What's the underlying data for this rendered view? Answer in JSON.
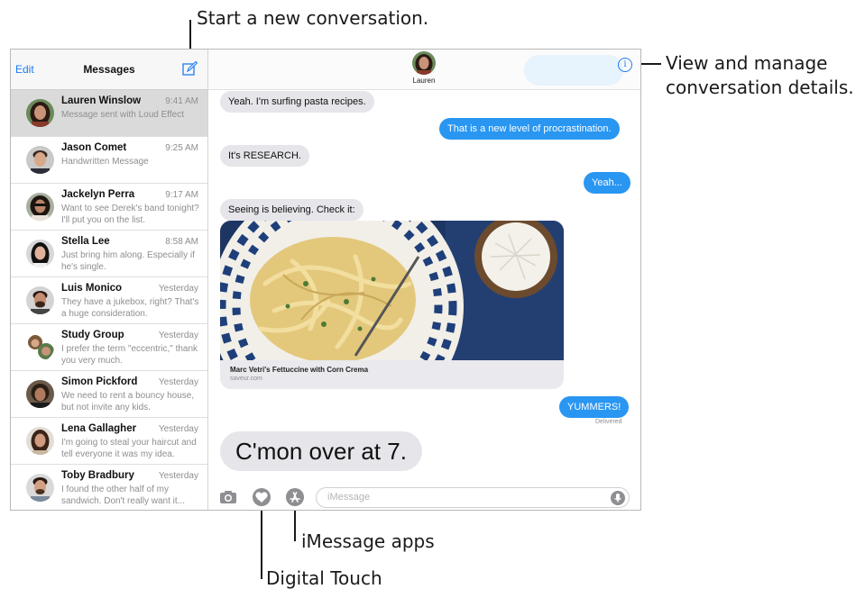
{
  "callouts": {
    "new_conversation": "Start a new conversation.",
    "details_line1": "View and manage",
    "details_line2": "conversation details.",
    "imessage_apps": "iMessage apps",
    "digital_touch": "Digital Touch"
  },
  "sidebar": {
    "edit_label": "Edit",
    "title": "Messages",
    "compose_icon": "compose-icon",
    "conversations": [
      {
        "name": "Lauren Winslow",
        "time": "9:41 AM",
        "preview": "Message sent with Loud Effect",
        "active": true
      },
      {
        "name": "Jason Comet",
        "time": "9:25 AM",
        "preview": "Handwritten Message"
      },
      {
        "name": "Jackelyn Perra",
        "time": "9:17 AM",
        "preview": "Want to see Derek's band tonight? I'll put you on the list."
      },
      {
        "name": "Stella Lee",
        "time": "8:58 AM",
        "preview": "Just bring him along. Especially if he's single."
      },
      {
        "name": "Luis Monico",
        "time": "Yesterday",
        "preview": "They have a jukebox, right? That's a huge consideration."
      },
      {
        "name": "Study Group",
        "time": "Yesterday",
        "preview": "I prefer the term \"eccentric,\" thank you very much."
      },
      {
        "name": "Simon Pickford",
        "time": "Yesterday",
        "preview": "We need to rent a bouncy house, but not invite any kids."
      },
      {
        "name": "Lena Gallagher",
        "time": "Yesterday",
        "preview": "I'm going to steal your haircut and tell everyone it was my idea."
      },
      {
        "name": "Toby Bradbury",
        "time": "Yesterday",
        "preview": "I found the other half of my sandwich. Don't really want it..."
      }
    ]
  },
  "chat": {
    "contact_name": "Lauren",
    "info_icon": "info-icon",
    "messages": [
      {
        "text": "Yeah. I'm surfing pasta recipes.",
        "direction": "incoming"
      },
      {
        "text": "That is a new level of procrastination.",
        "direction": "outgoing"
      },
      {
        "text": "It's RESEARCH.",
        "direction": "incoming"
      },
      {
        "text": "Yeah...",
        "direction": "outgoing"
      },
      {
        "text": "Seeing is believing. Check it:",
        "direction": "incoming"
      },
      {
        "text": "YUMMERS!",
        "direction": "outgoing"
      },
      {
        "text": "C'mon over at 7.",
        "direction": "incoming",
        "effect": "loud"
      }
    ],
    "link_preview": {
      "title": "Marc Vetri's Fettuccine with Corn Crema",
      "domain": "saveur.com"
    },
    "delivered_label": "Delivered",
    "input": {
      "placeholder": "iMessage",
      "icons": [
        "camera-icon",
        "digital-touch-icon",
        "app-store-icon",
        "microphone-icon"
      ]
    }
  },
  "colors": {
    "accent": "#1c7cf4",
    "outgoing_bubble": "#2996f2",
    "incoming_bubble": "#e5e5ea",
    "plate_blue": "#1e3f7a"
  }
}
